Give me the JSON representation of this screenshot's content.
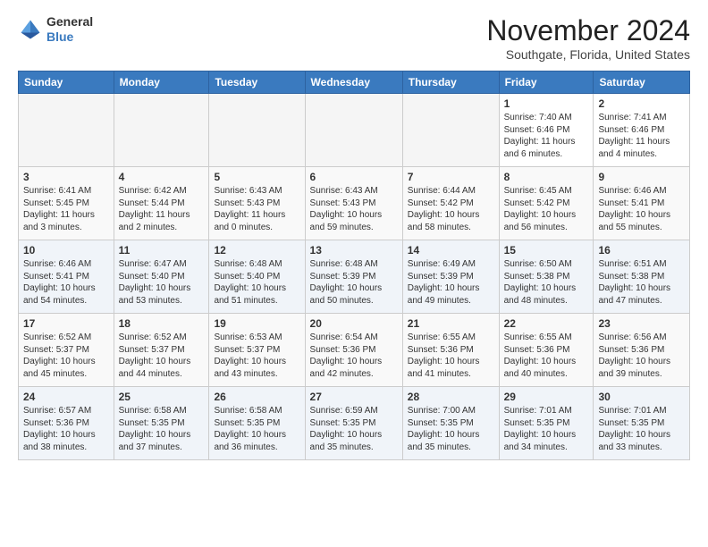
{
  "header": {
    "logo_line1": "General",
    "logo_line2": "Blue",
    "month": "November 2024",
    "location": "Southgate, Florida, United States"
  },
  "weekdays": [
    "Sunday",
    "Monday",
    "Tuesday",
    "Wednesday",
    "Thursday",
    "Friday",
    "Saturday"
  ],
  "weeks": [
    [
      {
        "day": "",
        "info": ""
      },
      {
        "day": "",
        "info": ""
      },
      {
        "day": "",
        "info": ""
      },
      {
        "day": "",
        "info": ""
      },
      {
        "day": "",
        "info": ""
      },
      {
        "day": "1",
        "info": "Sunrise: 7:40 AM\nSunset: 6:46 PM\nDaylight: 11 hours and 6 minutes."
      },
      {
        "day": "2",
        "info": "Sunrise: 7:41 AM\nSunset: 6:46 PM\nDaylight: 11 hours and 4 minutes."
      }
    ],
    [
      {
        "day": "3",
        "info": "Sunrise: 6:41 AM\nSunset: 5:45 PM\nDaylight: 11 hours and 3 minutes."
      },
      {
        "day": "4",
        "info": "Sunrise: 6:42 AM\nSunset: 5:44 PM\nDaylight: 11 hours and 2 minutes."
      },
      {
        "day": "5",
        "info": "Sunrise: 6:43 AM\nSunset: 5:43 PM\nDaylight: 11 hours and 0 minutes."
      },
      {
        "day": "6",
        "info": "Sunrise: 6:43 AM\nSunset: 5:43 PM\nDaylight: 10 hours and 59 minutes."
      },
      {
        "day": "7",
        "info": "Sunrise: 6:44 AM\nSunset: 5:42 PM\nDaylight: 10 hours and 58 minutes."
      },
      {
        "day": "8",
        "info": "Sunrise: 6:45 AM\nSunset: 5:42 PM\nDaylight: 10 hours and 56 minutes."
      },
      {
        "day": "9",
        "info": "Sunrise: 6:46 AM\nSunset: 5:41 PM\nDaylight: 10 hours and 55 minutes."
      }
    ],
    [
      {
        "day": "10",
        "info": "Sunrise: 6:46 AM\nSunset: 5:41 PM\nDaylight: 10 hours and 54 minutes."
      },
      {
        "day": "11",
        "info": "Sunrise: 6:47 AM\nSunset: 5:40 PM\nDaylight: 10 hours and 53 minutes."
      },
      {
        "day": "12",
        "info": "Sunrise: 6:48 AM\nSunset: 5:40 PM\nDaylight: 10 hours and 51 minutes."
      },
      {
        "day": "13",
        "info": "Sunrise: 6:48 AM\nSunset: 5:39 PM\nDaylight: 10 hours and 50 minutes."
      },
      {
        "day": "14",
        "info": "Sunrise: 6:49 AM\nSunset: 5:39 PM\nDaylight: 10 hours and 49 minutes."
      },
      {
        "day": "15",
        "info": "Sunrise: 6:50 AM\nSunset: 5:38 PM\nDaylight: 10 hours and 48 minutes."
      },
      {
        "day": "16",
        "info": "Sunrise: 6:51 AM\nSunset: 5:38 PM\nDaylight: 10 hours and 47 minutes."
      }
    ],
    [
      {
        "day": "17",
        "info": "Sunrise: 6:52 AM\nSunset: 5:37 PM\nDaylight: 10 hours and 45 minutes."
      },
      {
        "day": "18",
        "info": "Sunrise: 6:52 AM\nSunset: 5:37 PM\nDaylight: 10 hours and 44 minutes."
      },
      {
        "day": "19",
        "info": "Sunrise: 6:53 AM\nSunset: 5:37 PM\nDaylight: 10 hours and 43 minutes."
      },
      {
        "day": "20",
        "info": "Sunrise: 6:54 AM\nSunset: 5:36 PM\nDaylight: 10 hours and 42 minutes."
      },
      {
        "day": "21",
        "info": "Sunrise: 6:55 AM\nSunset: 5:36 PM\nDaylight: 10 hours and 41 minutes."
      },
      {
        "day": "22",
        "info": "Sunrise: 6:55 AM\nSunset: 5:36 PM\nDaylight: 10 hours and 40 minutes."
      },
      {
        "day": "23",
        "info": "Sunrise: 6:56 AM\nSunset: 5:36 PM\nDaylight: 10 hours and 39 minutes."
      }
    ],
    [
      {
        "day": "24",
        "info": "Sunrise: 6:57 AM\nSunset: 5:36 PM\nDaylight: 10 hours and 38 minutes."
      },
      {
        "day": "25",
        "info": "Sunrise: 6:58 AM\nSunset: 5:35 PM\nDaylight: 10 hours and 37 minutes."
      },
      {
        "day": "26",
        "info": "Sunrise: 6:58 AM\nSunset: 5:35 PM\nDaylight: 10 hours and 36 minutes."
      },
      {
        "day": "27",
        "info": "Sunrise: 6:59 AM\nSunset: 5:35 PM\nDaylight: 10 hours and 35 minutes."
      },
      {
        "day": "28",
        "info": "Sunrise: 7:00 AM\nSunset: 5:35 PM\nDaylight: 10 hours and 35 minutes."
      },
      {
        "day": "29",
        "info": "Sunrise: 7:01 AM\nSunset: 5:35 PM\nDaylight: 10 hours and 34 minutes."
      },
      {
        "day": "30",
        "info": "Sunrise: 7:01 AM\nSunset: 5:35 PM\nDaylight: 10 hours and 33 minutes."
      }
    ]
  ]
}
